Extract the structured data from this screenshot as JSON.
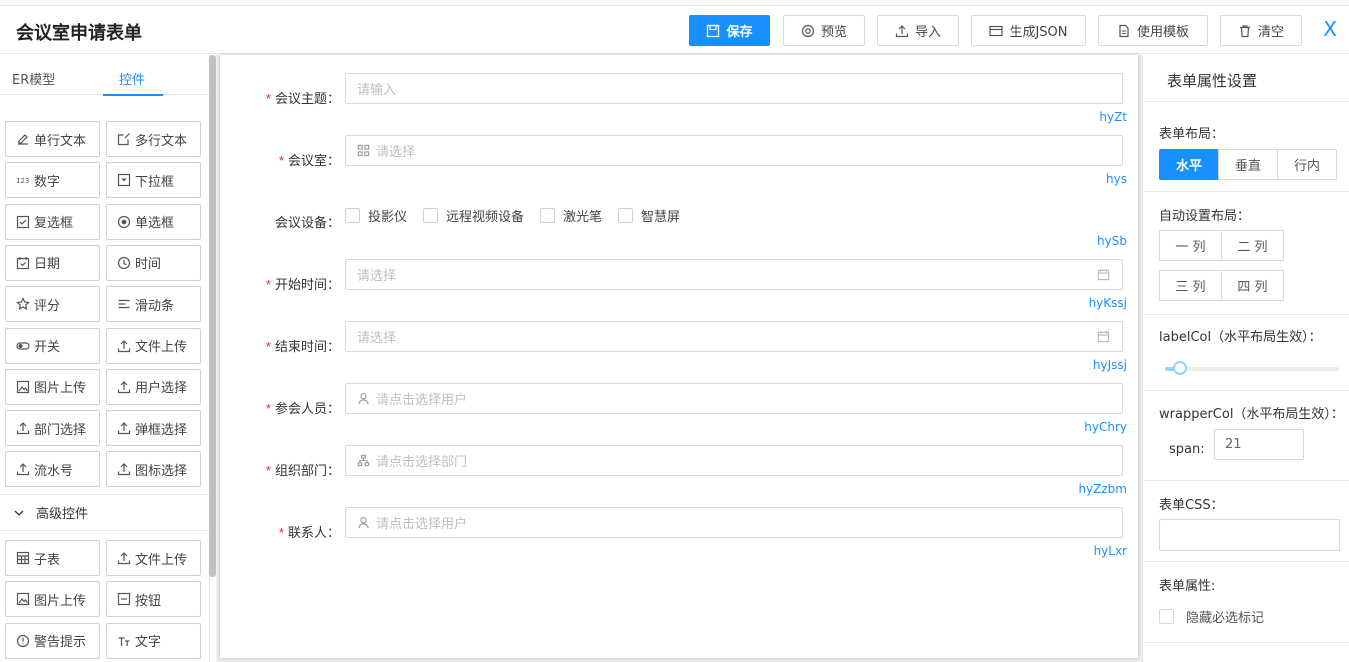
{
  "app": {
    "title": "会议室申请表单"
  },
  "toolbar": {
    "save_label": "保存",
    "preview_label": "预览",
    "import_label": "导入",
    "json_label": "生成JSON",
    "template_label": "使用模板",
    "clear_label": "清空",
    "close_label": "X",
    "accent_color": "#1890ff"
  },
  "left": {
    "tabs": [
      {
        "label": "ER模型"
      },
      {
        "label": "控件",
        "active": true
      }
    ],
    "controls": [
      {
        "label": "单行文本",
        "icon": "edit-icon"
      },
      {
        "label": "多行文本",
        "icon": "form-icon"
      },
      {
        "label": "数字",
        "icon": "number-icon"
      },
      {
        "label": "下拉框",
        "icon": "dropdown-icon"
      },
      {
        "label": "复选框",
        "icon": "checkbox-icon"
      },
      {
        "label": "单选框",
        "icon": "radio-icon"
      },
      {
        "label": "日期",
        "icon": "calendar-check-icon"
      },
      {
        "label": "时间",
        "icon": "clock-icon"
      },
      {
        "label": "评分",
        "icon": "star-icon"
      },
      {
        "label": "滑动条",
        "icon": "slider-icon"
      },
      {
        "label": "开关",
        "icon": "switch-icon"
      },
      {
        "label": "文件上传",
        "icon": "upload-icon"
      },
      {
        "label": "图片上传",
        "icon": "image-icon"
      },
      {
        "label": "用户选择",
        "icon": "upload-icon"
      },
      {
        "label": "部门选择",
        "icon": "upload-icon"
      },
      {
        "label": "弹框选择",
        "icon": "upload-icon"
      },
      {
        "label": "流水号",
        "icon": "upload-icon"
      },
      {
        "label": "图标选择",
        "icon": "upload-icon"
      }
    ],
    "advanced_header": "高级控件",
    "advanced_controls": [
      {
        "label": "子表",
        "icon": "table-icon"
      },
      {
        "label": "文件上传",
        "icon": "upload-icon"
      },
      {
        "label": "图片上传",
        "icon": "image-icon"
      },
      {
        "label": "按钮",
        "icon": "minus-square-icon"
      },
      {
        "label": "警告提示",
        "icon": "exclamation-circle-icon"
      },
      {
        "label": "文字",
        "icon": "font-size-icon"
      }
    ]
  },
  "form": {
    "fields": [
      {
        "label": "会议主题：",
        "required": true,
        "type": "input",
        "placeholder": "请输入",
        "field": "hyZt"
      },
      {
        "label": "会议室：",
        "required": true,
        "type": "select",
        "placeholder": "请选择",
        "icon": "appstore-icon",
        "field": "hys"
      },
      {
        "label": "会议设备：",
        "required": false,
        "type": "checkbox",
        "options": [
          "投影仪",
          "远程视频设备",
          "激光笔",
          "智慧屏"
        ],
        "field": "hySb"
      },
      {
        "label": "开始时间：",
        "required": true,
        "type": "date",
        "placeholder": "请选择",
        "field": "hyKssj"
      },
      {
        "label": "结束时间：",
        "required": true,
        "type": "date",
        "placeholder": "请选择",
        "field": "hyJssj"
      },
      {
        "label": "参会人员：",
        "required": true,
        "type": "user",
        "placeholder": "请点击选择用户",
        "icon": "user-icon",
        "field": "hyChry"
      },
      {
        "label": "组织部门：",
        "required": true,
        "type": "dept",
        "placeholder": "请点击选择部门",
        "icon": "apartment-icon",
        "field": "hyZzbm"
      },
      {
        "label": "联系人：",
        "required": true,
        "type": "user",
        "placeholder": "请点击选择用户",
        "icon": "user-icon",
        "field": "hyLxr"
      }
    ]
  },
  "right": {
    "title": "表单属性设置",
    "layout_label": "表单布局：",
    "layout_options": [
      {
        "label": "水平",
        "active": true
      },
      {
        "label": "垂直"
      },
      {
        "label": "行内"
      }
    ],
    "auto_layout_label": "自动设置布局：",
    "col_options": [
      "一 列",
      "二 列",
      "三 列",
      "四 列"
    ],
    "label_col_label": "labelCol（水平布局生效）：",
    "label_col_value": 2,
    "label_col_max": 24,
    "wrapper_col_label": "wrapperCol（水平布局生效）：",
    "span_label": "span:",
    "span_value": "21",
    "css_label": "表单CSS：",
    "attr_label": "表单属性:",
    "hide_required_label": "隐藏必选标记"
  }
}
